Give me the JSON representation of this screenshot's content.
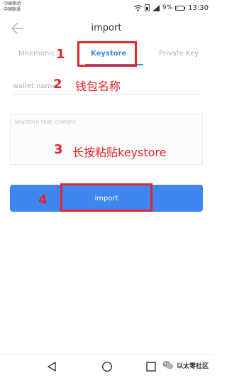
{
  "status_bar": {
    "carrier_1": "中国移动",
    "carrier_2": "中国联通",
    "battery": "9%",
    "time": "13:30"
  },
  "header": {
    "title": "import",
    "back_icon": "arrow-left-icon"
  },
  "tabs": [
    {
      "label": "Mnemonic",
      "active": false
    },
    {
      "label": "Keystore",
      "active": true
    },
    {
      "label": "Private Key",
      "active": false
    }
  ],
  "form": {
    "wallet_name_placeholder": "wallet name",
    "keystore_placeholder": "keystore text content",
    "import_label": "import"
  },
  "annotations": {
    "n1": "1",
    "n2": "2",
    "n3": "3",
    "n4": "4",
    "text_2": "钱包名称",
    "text_3": "长按粘贴keystore"
  },
  "watermark": {
    "text": "以太零社区",
    "icon": "wechat-icon"
  },
  "colors": {
    "accent": "#3f86f0",
    "annotation": "#e5252a"
  }
}
